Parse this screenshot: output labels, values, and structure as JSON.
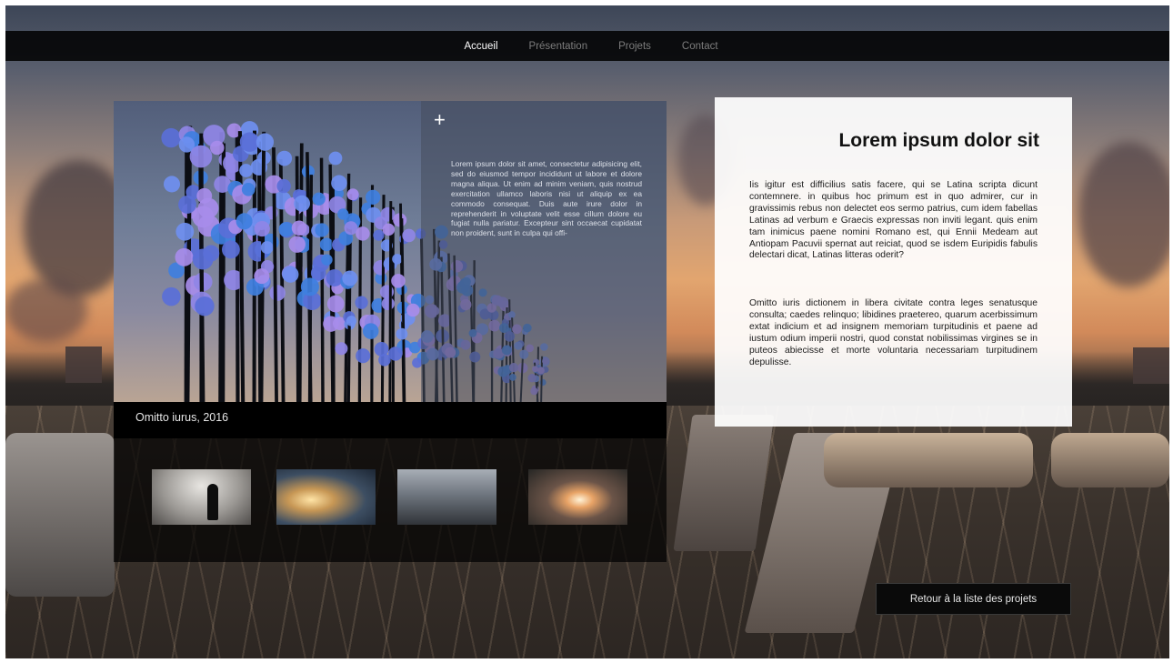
{
  "nav": {
    "items": [
      {
        "label": "Accueil",
        "active": true
      },
      {
        "label": "Présentation",
        "active": false
      },
      {
        "label": "Projets",
        "active": false
      },
      {
        "label": "Contact",
        "active": false
      }
    ]
  },
  "project": {
    "plus_icon": "plus-icon",
    "overlay_text": "Lorem ipsum dolor sit amet, consectetur adipisicing elit, sed do eiusmod tempor incididunt ut labore et dolore magna aliqua. Ut enim ad minim veniam, quis nostrud exercitation ullamco laboris nisi ut aliquip ex ea commodo consequat. Duis aute irure dolor in reprehenderit in voluptate velit esse cillum dolore eu fugiat nulla pariatur. Excepteur sint occaecat cupidatat non proident, sunt in culpa qui offi-",
    "caption": "Omitto iurus, 2016"
  },
  "content": {
    "title": "Lorem ipsum dolor sit",
    "paragraphs": [
      "Iis igitur est difficilius satis facere, qui se Latina scripta dicunt contemnere. in quibus hoc primum est in quo admirer, cur in gravissimis rebus non delectet eos sermo patrius, cum idem fabellas Latinas ad verbum e Graecis expressas non inviti legant. quis enim tam inimicus paene nomini Romano est, qui Ennii Medeam aut Antiopam Pacuvii spernat aut reiciat, quod se isdem Euripidis fabulis delectari dicat, Latinas litteras oderit?",
      "Omitto iuris dictionem in libera civitate contra leges senatusque consulta; caedes relinquo; libidines praetereo, quarum acerbissimum extat indicium et ad insignem memoriam turpitudinis et paene ad iustum odium imperii nostri, quod constat nobilissimas virgines se in puteos abiecisse et morte voluntaria necessariam turpitudinem depulisse."
    ]
  },
  "back_button": {
    "label": "Retour à la liste des projets"
  },
  "colors": {
    "nav_active": "#ffffff",
    "nav_inactive": "#7d7d7d",
    "orb_palette": [
      "#3f7fe0",
      "#6f8ff0",
      "#8f86e6",
      "#a78cea",
      "#5a6fd8"
    ]
  }
}
